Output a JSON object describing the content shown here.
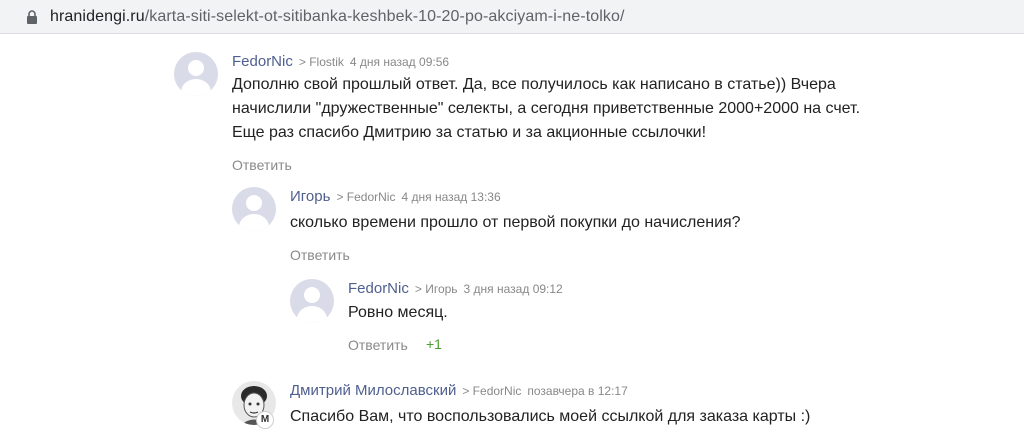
{
  "browser": {
    "url_host": "hranidengi.ru",
    "url_path": "/karta-siti-selekt-ot-sitibanka-keshbek-10-20-po-akciyam-i-ne-tolko/",
    "lock_icon": "lock-icon"
  },
  "comments": [
    {
      "author": "FedorNic",
      "reply_to": "> Flostik",
      "date": "4 дня назад 09:56",
      "text": "Дополню свой прошлый ответ. Да, все получилось как написано в статье)) Вчера начислили \"дружественные\" селекты, а сегодня приветственные 2000+2000 на счет. Еще раз спасибо Дмитрию за статью и за акционные ссылочки!",
      "reply_label": "Ответить",
      "avatar": "user-placeholder-icon"
    },
    {
      "author": "Игорь",
      "reply_to": "> FedorNic",
      "date": "4 дня назад 13:36",
      "text": "сколько времени прошло от первой покупки до начисления?",
      "reply_label": "Ответить",
      "avatar": "user-placeholder-icon"
    },
    {
      "author": "FedorNic",
      "reply_to": "> Игорь",
      "date": "3 дня назад 09:12",
      "text": "Ровно месяц.",
      "reply_label": "Ответить",
      "rating": "+1",
      "avatar": "user-placeholder-icon"
    },
    {
      "author": "Дмитрий Милославский",
      "reply_to": "> FedorNic",
      "date": "позавчера в 12:17",
      "text": "Спасибо Вам, что воспользовались моей ссылкой для заказа карты :)",
      "badge": "M",
      "avatar": "user-photo"
    }
  ],
  "colors": {
    "author": "#4f5f8f",
    "meta": "#888888",
    "text": "#222222",
    "rating": "#4a9b2f",
    "avatar_bg": "#d9dbe8"
  }
}
